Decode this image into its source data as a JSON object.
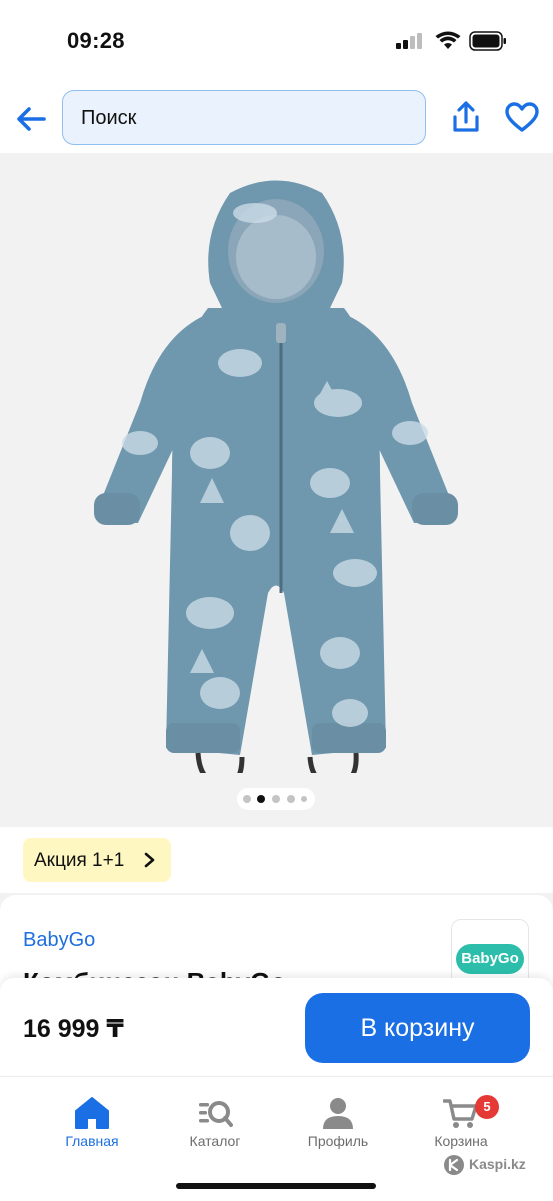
{
  "status_bar": {
    "time": "09:28"
  },
  "header": {
    "search_placeholder": "Поиск"
  },
  "gallery": {
    "slide_count": 5,
    "active_slide": 2
  },
  "promo": {
    "label": "Акция 1+1"
  },
  "product": {
    "brand": "BabyGo",
    "title": "Комбинезон BabyGo",
    "brand_logo_text": "BabyGo"
  },
  "buy_bar": {
    "price": "16 999 ₸",
    "cart_button": "В корзину"
  },
  "tabs": [
    {
      "label": "Главная",
      "icon": "home-icon",
      "active": true
    },
    {
      "label": "Каталог",
      "icon": "catalog-search-icon",
      "active": false
    },
    {
      "label": "Профиль",
      "icon": "profile-icon",
      "active": false
    },
    {
      "label": "Корзина",
      "icon": "cart-icon",
      "active": false,
      "badge": "5"
    }
  ],
  "watermark": "Kaspi.kz",
  "colors": {
    "accent": "#1a6fe4",
    "promo_bg": "#fff7c2",
    "badge": "#e53935",
    "jumpsuit": "#6f97ad"
  }
}
